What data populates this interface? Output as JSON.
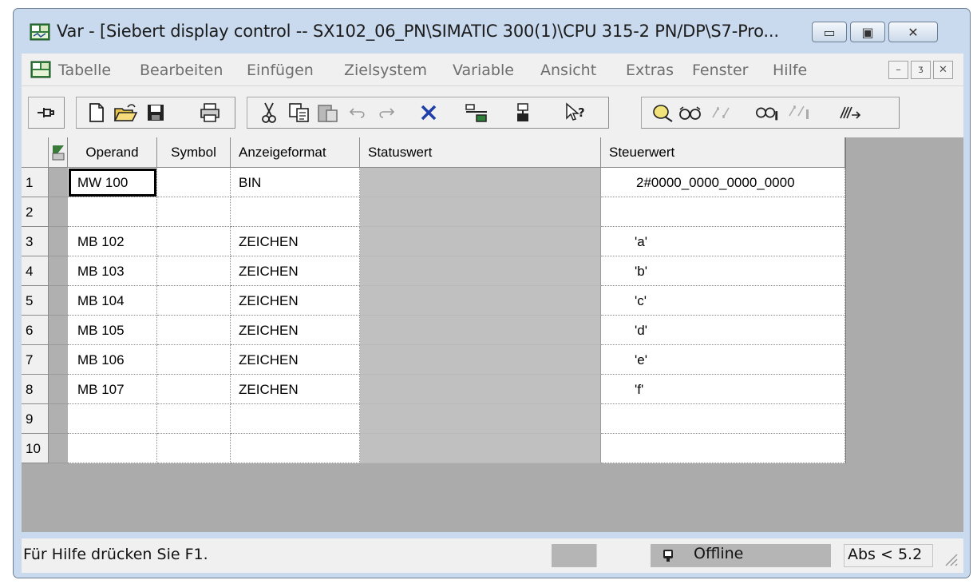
{
  "window": {
    "title": "Var - [Siebert display control -- SX102_06_PN\\SIMATIC 300(1)\\CPU 315-2 PN/DP\\S7-Pro...",
    "minimize_glyph": "▭",
    "maximize_glyph": "▣",
    "close_glyph": "✕"
  },
  "menu": {
    "items": [
      "Tabelle",
      "Bearbeiten",
      "Einfügen",
      "Zielsystem",
      "Variable",
      "Ansicht",
      "Extras",
      "Fenster",
      "Hilfe"
    ],
    "mdi_minimize": "–",
    "mdi_restore": "ᴣ",
    "mdi_close": "✕"
  },
  "toolbar": {
    "icons": [
      "pin-icon",
      "new-file-icon",
      "open-folder-icon",
      "save-icon",
      "print-icon",
      "cut-icon",
      "copy-icon",
      "paste-icon",
      "undo-icon",
      "redo-icon",
      "delete-icon",
      "accessible-nodes-icon",
      "online-icon",
      "help-pointer-icon",
      "monitor-variable-icon",
      "glasses-icon",
      "modify-icon",
      "glasses-trigger-icon",
      "modify-trigger-icon",
      "force-icon"
    ]
  },
  "table": {
    "columns": [
      "Operand",
      "Symbol",
      "Anzeigeformat",
      "Statuswert",
      "Steuerwert"
    ],
    "rows": [
      {
        "num": "1",
        "operand": "MW  100",
        "symbol": "",
        "format": "BIN",
        "status": "",
        "control": "2#0000_0000_0000_0000"
      },
      {
        "num": "2",
        "operand": "",
        "symbol": "",
        "format": "",
        "status": "",
        "control": ""
      },
      {
        "num": "3",
        "operand": "MB  102",
        "symbol": "",
        "format": "ZEICHEN",
        "status": "",
        "control": "'a'"
      },
      {
        "num": "4",
        "operand": "MB  103",
        "symbol": "",
        "format": "ZEICHEN",
        "status": "",
        "control": "'b'"
      },
      {
        "num": "5",
        "operand": "MB  104",
        "symbol": "",
        "format": "ZEICHEN",
        "status": "",
        "control": "'c'"
      },
      {
        "num": "6",
        "operand": "MB  105",
        "symbol": "",
        "format": "ZEICHEN",
        "status": "",
        "control": "'d'"
      },
      {
        "num": "7",
        "operand": "MB  106",
        "symbol": "",
        "format": "ZEICHEN",
        "status": "",
        "control": "'e'"
      },
      {
        "num": "8",
        "operand": "MB  107",
        "symbol": "",
        "format": "ZEICHEN",
        "status": "",
        "control": "'f'"
      },
      {
        "num": "9",
        "operand": "",
        "symbol": "",
        "format": "",
        "status": "",
        "control": ""
      },
      {
        "num": "10",
        "operand": "",
        "symbol": "",
        "format": "",
        "status": "",
        "control": ""
      }
    ]
  },
  "statusbar": {
    "help_text": "Für Hilfe drücken Sie F1.",
    "connection": "Offline",
    "abs": "Abs < 5.2"
  },
  "colors": {
    "title_bar": "#c9daee",
    "grid_background": "#ababab",
    "status_column": "#c0c0c0",
    "chrome": "#f0f0f0"
  }
}
